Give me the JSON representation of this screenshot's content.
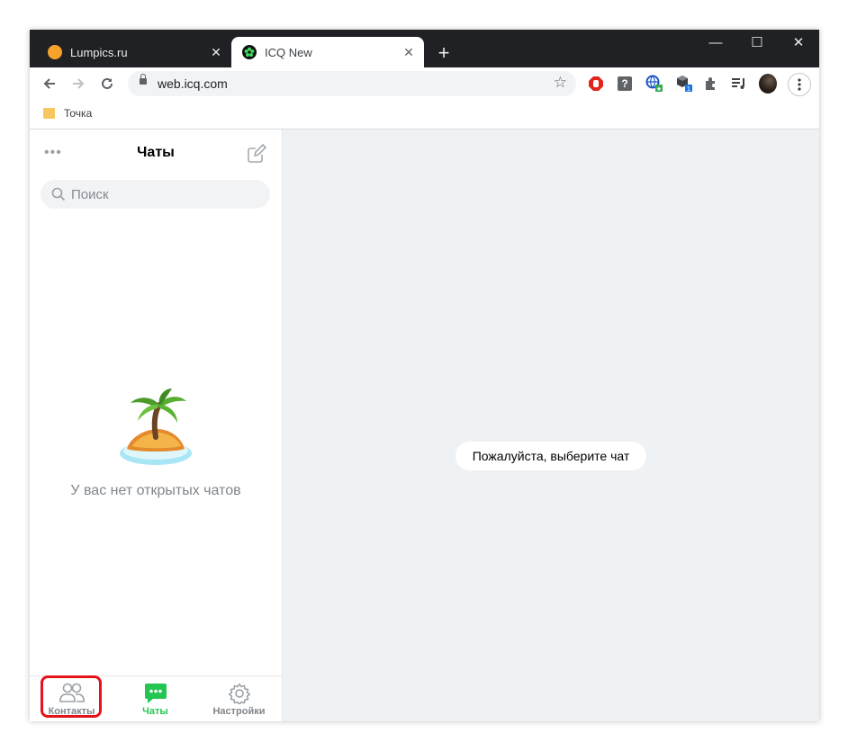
{
  "browser": {
    "tabs": [
      {
        "title": "Lumpics.ru",
        "favicon": "orange-circle-icon",
        "active": false
      },
      {
        "title": "ICQ New",
        "favicon": "icq-flower-icon",
        "active": true
      }
    ],
    "new_tab_symbol": "+",
    "window_controls": {
      "minimize": "—",
      "maximize": "☐",
      "close": "✕"
    },
    "url": "web.icq.com",
    "bookmarks": [
      {
        "label": "Точка",
        "icon": "folder-icon"
      }
    ],
    "colors": {
      "tabbar": "#202124",
      "omnibox": "#f1f3f4"
    }
  },
  "app": {
    "sidebar": {
      "title": "Чаты",
      "search_placeholder": "Поиск",
      "empty_message": "У вас нет открытых чатов",
      "empty_icon": "palm-island-icon"
    },
    "main": {
      "placeholder": "Пожалуйста, выберите чат"
    },
    "bottom_nav": [
      {
        "label": "Контакты",
        "icon": "contacts-icon",
        "active": false,
        "highlighted": true
      },
      {
        "label": "Чаты",
        "icon": "chats-icon",
        "active": true
      },
      {
        "label": "Настройки",
        "icon": "gear-icon",
        "active": false
      }
    ],
    "colors": {
      "accent": "#24c653",
      "inactive": "#9aa0a6",
      "highlight": "#e3141a",
      "main_bg": "#eff2f5"
    }
  }
}
